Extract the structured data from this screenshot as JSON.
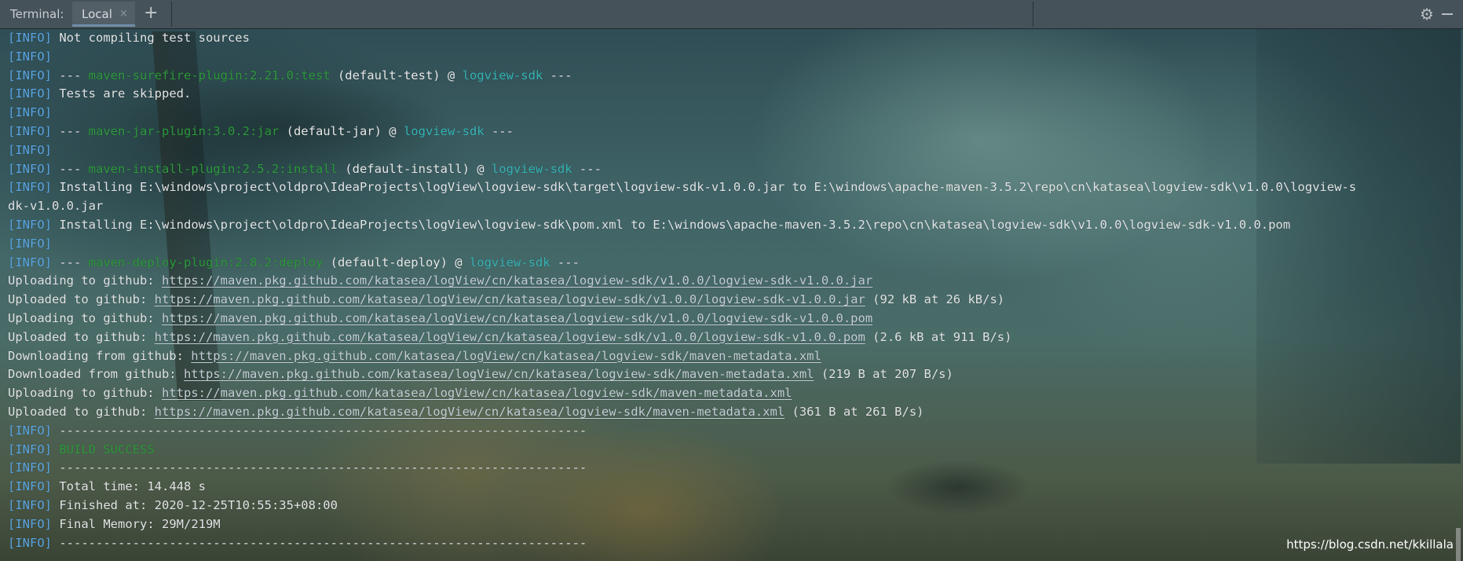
{
  "titlebar": {
    "label": "Terminal:",
    "tab_label": "Local",
    "tab_close": "×",
    "add_tab": "+"
  },
  "terminal": {
    "lines": [
      {
        "kind": "info",
        "text": "Not compiling test sources"
      },
      {
        "kind": "info",
        "text": ""
      },
      {
        "kind": "plugin",
        "prefix": "--- ",
        "plugin": "maven-surefire-plugin:2.21.0:test",
        "goal": " (default-test) @ ",
        "project": "logview-sdk",
        "suffix": " ---"
      },
      {
        "kind": "info",
        "text": "Tests are skipped."
      },
      {
        "kind": "info",
        "text": ""
      },
      {
        "kind": "plugin",
        "prefix": "--- ",
        "plugin": "maven-jar-plugin:3.0.2:jar",
        "goal": " (default-jar) @ ",
        "project": "logview-sdk",
        "suffix": " ---"
      },
      {
        "kind": "info",
        "text": ""
      },
      {
        "kind": "plugin",
        "prefix": "--- ",
        "plugin": "maven-install-plugin:2.5.2:install",
        "goal": " (default-install) @ ",
        "project": "logview-sdk",
        "suffix": " ---"
      },
      {
        "kind": "info",
        "text": "Installing E:\\windows\\project\\oldpro\\IdeaProjects\\logView\\logview-sdk\\target\\logview-sdk-v1.0.0.jar to E:\\windows\\apache-maven-3.5.2\\repo\\cn\\katasea\\logview-sdk\\v1.0.0\\logview-s"
      },
      {
        "kind": "plain",
        "text": "dk-v1.0.0.jar"
      },
      {
        "kind": "info",
        "text": "Installing E:\\windows\\project\\oldpro\\IdeaProjects\\logView\\logview-sdk\\pom.xml to E:\\windows\\apache-maven-3.5.2\\repo\\cn\\katasea\\logview-sdk\\v1.0.0\\logview-sdk-v1.0.0.pom"
      },
      {
        "kind": "info",
        "text": ""
      },
      {
        "kind": "plugin",
        "prefix": "--- ",
        "plugin": "maven-deploy-plugin:2.8.2:deploy",
        "goal": " (default-deploy) @ ",
        "project": "logview-sdk",
        "suffix": " ---"
      },
      {
        "kind": "link",
        "text": "Uploading to github: ",
        "url": "https://maven.pkg.github.com/katasea/logView/cn/katasea/logview-sdk/v1.0.0/logview-sdk-v1.0.0.jar",
        "tail": ""
      },
      {
        "kind": "link",
        "text": "Uploaded to github: ",
        "url": "https://maven.pkg.github.com/katasea/logView/cn/katasea/logview-sdk/v1.0.0/logview-sdk-v1.0.0.jar",
        "tail": " (92 kB at 26 kB/s)"
      },
      {
        "kind": "link",
        "text": "Uploading to github: ",
        "url": "https://maven.pkg.github.com/katasea/logView/cn/katasea/logview-sdk/v1.0.0/logview-sdk-v1.0.0.pom",
        "tail": ""
      },
      {
        "kind": "link",
        "text": "Uploaded to github: ",
        "url": "https://maven.pkg.github.com/katasea/logView/cn/katasea/logview-sdk/v1.0.0/logview-sdk-v1.0.0.pom",
        "tail": " (2.6 kB at 911 B/s)"
      },
      {
        "kind": "link",
        "text": "Downloading from github: ",
        "url": "https://maven.pkg.github.com/katasea/logView/cn/katasea/logview-sdk/maven-metadata.xml",
        "tail": ""
      },
      {
        "kind": "link",
        "text": "Downloaded from github: ",
        "url": "https://maven.pkg.github.com/katasea/logView/cn/katasea/logview-sdk/maven-metadata.xml",
        "tail": " (219 B at 207 B/s)"
      },
      {
        "kind": "link",
        "text": "Uploading to github: ",
        "url": "https://maven.pkg.github.com/katasea/logView/cn/katasea/logview-sdk/maven-metadata.xml",
        "tail": ""
      },
      {
        "kind": "link",
        "text": "Uploaded to github: ",
        "url": "https://maven.pkg.github.com/katasea/logView/cn/katasea/logview-sdk/maven-metadata.xml",
        "tail": " (361 B at 261 B/s)"
      },
      {
        "kind": "info",
        "text": "------------------------------------------------------------------------"
      },
      {
        "kind": "success",
        "text": "BUILD SUCCESS"
      },
      {
        "kind": "info",
        "text": "------------------------------------------------------------------------"
      },
      {
        "kind": "info",
        "text": "Total time: 14.448 s"
      },
      {
        "kind": "info",
        "text": "Finished at: 2020-12-25T10:55:35+08:00"
      },
      {
        "kind": "info",
        "text": "Final Memory: 29M/219M"
      },
      {
        "kind": "info",
        "text": "------------------------------------------------------------------------"
      }
    ],
    "info_tag": "[INFO]"
  },
  "watermark": "https://blog.csdn.net/kkillala",
  "colors": {
    "info_tag": "#5aa6e3",
    "plugin": "#2d9a3c",
    "project": "#36b4b4",
    "success": "#2f9a3c",
    "text": "#e2e4e6"
  },
  "icons": {
    "settings": "gear-icon",
    "minimize": "minimize-icon",
    "add": "add-tab-icon",
    "close": "close-icon"
  }
}
